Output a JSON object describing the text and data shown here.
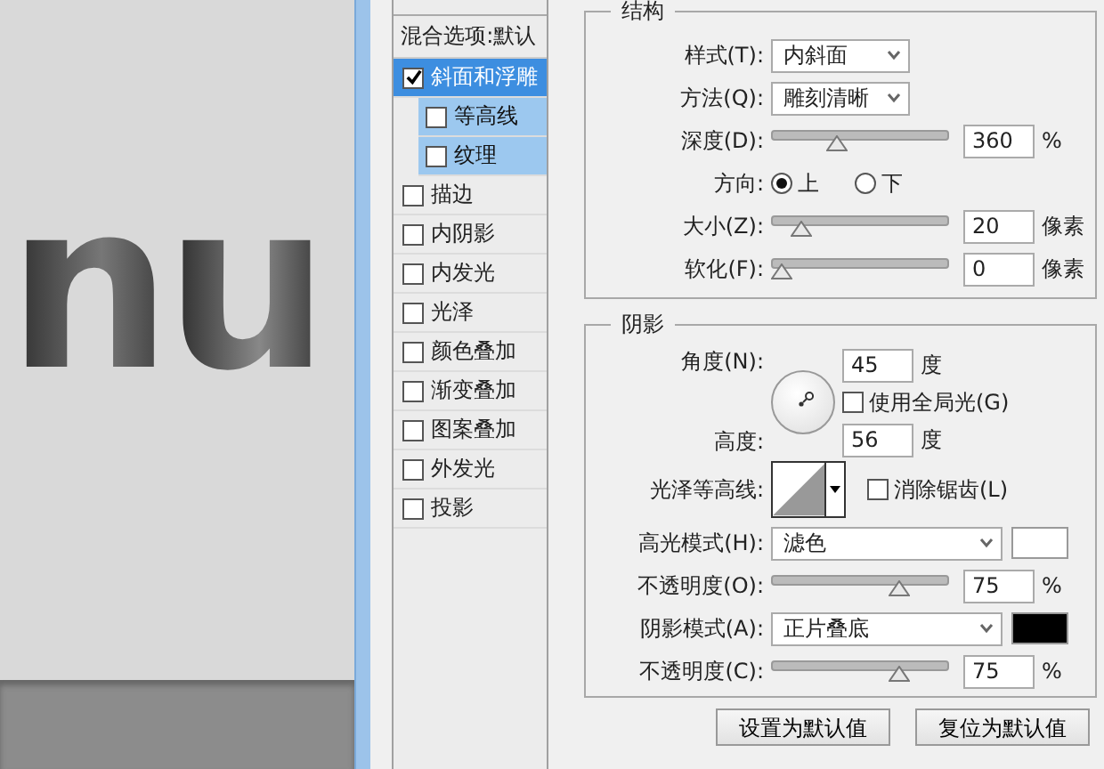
{
  "canvas": {
    "text": "nu"
  },
  "styles_panel": {
    "header": "混合选项:默认",
    "items": [
      {
        "label": "斜面和浮雕",
        "checked": true,
        "selected": true,
        "children": [
          {
            "label": "等高线",
            "checked": false,
            "selected": false
          },
          {
            "label": "纹理",
            "checked": false,
            "selected": false
          }
        ]
      },
      {
        "label": "描边",
        "checked": false,
        "selected": false
      },
      {
        "label": "内阴影",
        "checked": false,
        "selected": false
      },
      {
        "label": "内发光",
        "checked": false,
        "selected": false
      },
      {
        "label": "光泽",
        "checked": false,
        "selected": false
      },
      {
        "label": "颜色叠加",
        "checked": false,
        "selected": false
      },
      {
        "label": "渐变叠加",
        "checked": false,
        "selected": false
      },
      {
        "label": "图案叠加",
        "checked": false,
        "selected": false
      },
      {
        "label": "外发光",
        "checked": false,
        "selected": false
      },
      {
        "label": "投影",
        "checked": false,
        "selected": false
      }
    ]
  },
  "structure": {
    "title": "结构",
    "rows": [
      {
        "kind": "dropdown",
        "label": "样式(T):",
        "value": "内斜面"
      },
      {
        "kind": "dropdown",
        "label": "方法(Q):",
        "value": "雕刻清晰"
      },
      {
        "kind": "slider",
        "label": "深度(D):",
        "level": 0.35,
        "value": "360",
        "unit": "%"
      },
      {
        "kind": "radio",
        "label": "方向:",
        "options": [
          {
            "label": "上",
            "selected": true
          },
          {
            "label": "下",
            "selected": false
          }
        ]
      },
      {
        "kind": "slider",
        "label": "大小(Z):",
        "level": 0.13,
        "value": "20",
        "unit": "像素"
      },
      {
        "kind": "slider",
        "label": "软化(F):",
        "level": 0,
        "value": "0",
        "unit": "像素"
      }
    ]
  },
  "shading": {
    "title": "阴影",
    "angle": {
      "label": "角度(N):",
      "value": "45",
      "unit": "度"
    },
    "global_light": {
      "label": "使用全局光(G)",
      "checked": false
    },
    "altitude": {
      "label": "高度:",
      "value": "56",
      "unit": "度"
    },
    "gloss_contour": {
      "label": "光泽等高线:"
    },
    "anti_aliased": {
      "label": "消除锯齿(L)",
      "checked": false
    },
    "rows": [
      {
        "kind": "mode",
        "label": "高光模式(H):",
        "value": "滤色",
        "color": "#ffffff"
      },
      {
        "kind": "slider",
        "label": "不透明度(O):",
        "level": 0.75,
        "value": "75",
        "unit": "%"
      },
      {
        "kind": "mode",
        "label": "阴影模式(A):",
        "value": "正片叠底",
        "color": "#000000"
      },
      {
        "kind": "slider",
        "label": "不透明度(C):",
        "level": 0.75,
        "value": "75",
        "unit": "%"
      }
    ]
  },
  "buttons": [
    "设置为默认值",
    "复位为默认值"
  ]
}
